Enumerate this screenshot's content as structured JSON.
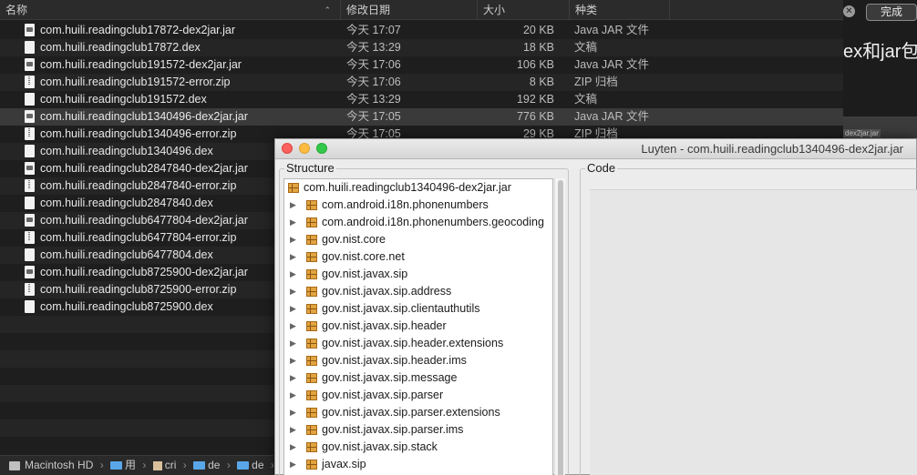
{
  "finder": {
    "columns": {
      "name": "名称",
      "date": "修改日期",
      "size": "大小",
      "kind": "种类",
      "sort_indicator": "⌃"
    },
    "files": [
      {
        "name": "com.huili.readingclub17872-dex2jar.jar",
        "date": "今天 17:07",
        "size": "20 KB",
        "kind": "Java JAR 文件",
        "icon": "jar-file-icon"
      },
      {
        "name": "com.huili.readingclub17872.dex",
        "date": "今天 13:29",
        "size": "18 KB",
        "kind": "文稿",
        "icon": "document-file-icon"
      },
      {
        "name": "com.huili.readingclub191572-dex2jar.jar",
        "date": "今天 17:06",
        "size": "106 KB",
        "kind": "Java JAR 文件",
        "icon": "jar-file-icon"
      },
      {
        "name": "com.huili.readingclub191572-error.zip",
        "date": "今天 17:06",
        "size": "8 KB",
        "kind": "ZIP 归档",
        "icon": "zip-file-icon"
      },
      {
        "name": "com.huili.readingclub191572.dex",
        "date": "今天 13:29",
        "size": "192 KB",
        "kind": "文稿",
        "icon": "document-file-icon"
      },
      {
        "name": "com.huili.readingclub1340496-dex2jar.jar",
        "date": "今天 17:05",
        "size": "776 KB",
        "kind": "Java JAR 文件",
        "icon": "jar-file-icon",
        "selected": true
      },
      {
        "name": "com.huili.readingclub1340496-error.zip",
        "date": "今天 17:05",
        "size": "29 KB",
        "kind": "ZIP 归档",
        "icon": "zip-file-icon"
      },
      {
        "name": "com.huili.readingclub1340496.dex",
        "date": "",
        "size": "",
        "kind": "",
        "icon": "document-file-icon"
      },
      {
        "name": "com.huili.readingclub2847840-dex2jar.jar",
        "date": "",
        "size": "",
        "kind": "",
        "icon": "jar-file-icon"
      },
      {
        "name": "com.huili.readingclub2847840-error.zip",
        "date": "",
        "size": "",
        "kind": "",
        "icon": "zip-file-icon"
      },
      {
        "name": "com.huili.readingclub2847840.dex",
        "date": "",
        "size": "",
        "kind": "",
        "icon": "document-file-icon"
      },
      {
        "name": "com.huili.readingclub6477804-dex2jar.jar",
        "date": "",
        "size": "",
        "kind": "",
        "icon": "jar-file-icon"
      },
      {
        "name": "com.huili.readingclub6477804-error.zip",
        "date": "",
        "size": "",
        "kind": "",
        "icon": "zip-file-icon"
      },
      {
        "name": "com.huili.readingclub6477804.dex",
        "date": "",
        "size": "",
        "kind": "",
        "icon": "document-file-icon"
      },
      {
        "name": "com.huili.readingclub8725900-dex2jar.jar",
        "date": "",
        "size": "",
        "kind": "",
        "icon": "jar-file-icon"
      },
      {
        "name": "com.huili.readingclub8725900-error.zip",
        "date": "",
        "size": "",
        "kind": "",
        "icon": "zip-file-icon"
      },
      {
        "name": "com.huili.readingclub8725900.dex",
        "date": "",
        "size": "",
        "kind": "",
        "icon": "document-file-icon"
      }
    ],
    "path_bar": {
      "disk": "Macintosh HD",
      "segments": [
        "用",
        "cri",
        "de",
        "de"
      ],
      "separator": "›"
    }
  },
  "background": {
    "done_label": "完成",
    "clear_glyph": "✕",
    "partial_text": "ex和jar包",
    "thumb_label": "dex2jar.jar"
  },
  "luyten": {
    "title": "Luyten - com.huili.readingclub1340496-dex2jar.jar",
    "structure_label": "Structure",
    "code_label": "Code",
    "root": "com.huili.readingclub1340496-dex2jar.jar",
    "expand_glyph": "▶",
    "packages": [
      "com.android.i18n.phonenumbers",
      "com.android.i18n.phonenumbers.geocoding",
      "gov.nist.core",
      "gov.nist.core.net",
      "gov.nist.javax.sip",
      "gov.nist.javax.sip.address",
      "gov.nist.javax.sip.clientauthutils",
      "gov.nist.javax.sip.header",
      "gov.nist.javax.sip.header.extensions",
      "gov.nist.javax.sip.header.ims",
      "gov.nist.javax.sip.message",
      "gov.nist.javax.sip.parser",
      "gov.nist.javax.sip.parser.extensions",
      "gov.nist.javax.sip.parser.ims",
      "gov.nist.javax.sip.stack",
      "javax.sip"
    ]
  },
  "colors": {
    "finder_bg": "#1e1e1e",
    "selected_row": "#3a3a3a",
    "close": "#fc605c",
    "minimize": "#fdbc40",
    "maximize": "#34c84a",
    "package_icon": "#e2a440"
  }
}
